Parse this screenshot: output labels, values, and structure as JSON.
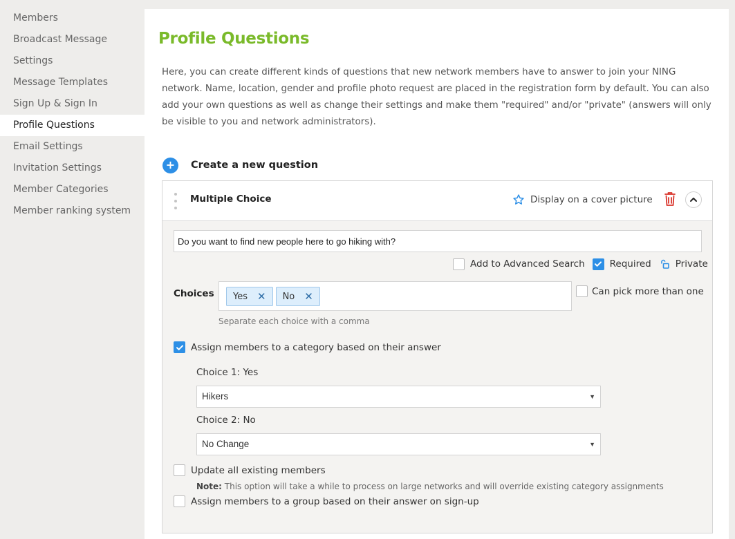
{
  "sidebar": {
    "items": [
      {
        "label": "Members"
      },
      {
        "label": "Broadcast Message"
      },
      {
        "label": "Settings"
      },
      {
        "label": "Message Templates"
      },
      {
        "label": "Sign Up & Sign In"
      },
      {
        "label": "Profile Questions",
        "active": true
      },
      {
        "label": "Email Settings"
      },
      {
        "label": "Invitation Settings"
      },
      {
        "label": "Member Categories"
      },
      {
        "label": "Member ranking system"
      }
    ]
  },
  "page": {
    "title": "Profile Questions",
    "description": "Here, you can create different kinds of questions that new network members have to answer to join your NING network. Name, location, gender and profile photo request are placed in the registration form by default. You can also add your own questions as well as change their settings and make them \"required\" and/or \"private\" (answers will only be visible to you and network administrators).",
    "create_label": "Create a new question"
  },
  "question": {
    "type": "Multiple Choice",
    "cover_label": "Display on a cover picture",
    "text": "Do you want to find new people here to go hiking with?",
    "add_search_label": "Add to Advanced Search",
    "add_search_checked": false,
    "required_label": "Required",
    "required_checked": true,
    "private_label": "Private",
    "choices_label": "Choices",
    "choices": [
      "Yes",
      "No"
    ],
    "pick_more_label": "Can pick more than one",
    "pick_more_checked": false,
    "helper": "Separate each choice with a comma",
    "assign_label": "Assign members to a category based on their answer",
    "assign_checked": true,
    "choice1_label": "Choice 1: Yes",
    "choice1_value": "Hikers",
    "choice2_label": "Choice 2: No",
    "choice2_value": "No Change",
    "update_label": "Update all existing members",
    "update_checked": false,
    "note_prefix": "Note:",
    "note_text": " This option will take a while to process on large networks and will override existing category assignments",
    "group_label": "Assign members to a group based on their answer on sign-up",
    "group_checked": false
  },
  "colors": {
    "accent": "#2d8fe6",
    "title": "#7aba2a",
    "danger": "#d9342b"
  }
}
